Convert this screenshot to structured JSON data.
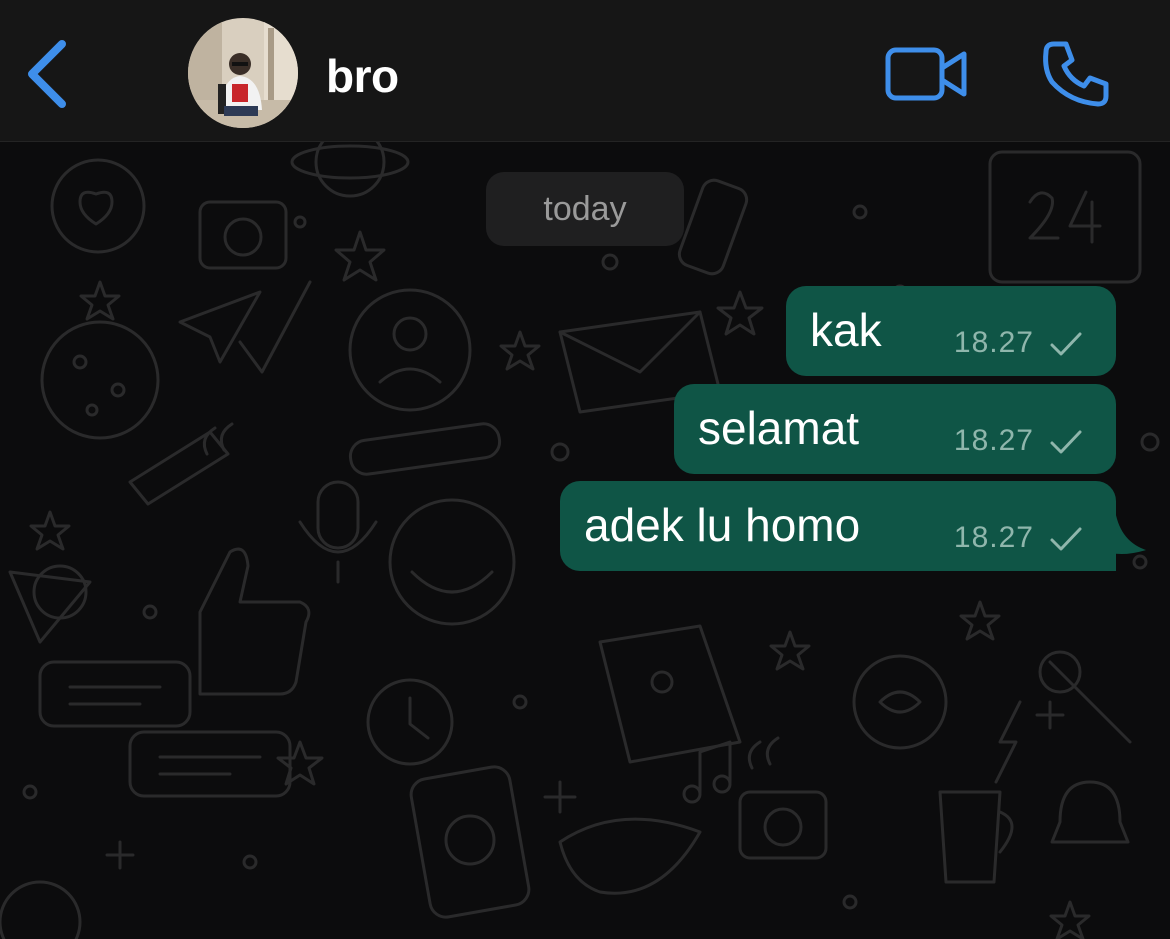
{
  "header": {
    "contact_name": "bro",
    "accent_color": "#3e8eea"
  },
  "chat": {
    "date_label": "today",
    "bubble_color": "#0f5546",
    "messages": [
      {
        "text": "kak",
        "time": "18.27",
        "status": "sent"
      },
      {
        "text": "selamat",
        "time": "18.27",
        "status": "sent"
      },
      {
        "text": "adek lu homo",
        "time": "18.27",
        "status": "sent"
      }
    ]
  },
  "icons": [
    "back-chevron-icon",
    "video-call-icon",
    "phone-icon",
    "single-check-icon"
  ]
}
